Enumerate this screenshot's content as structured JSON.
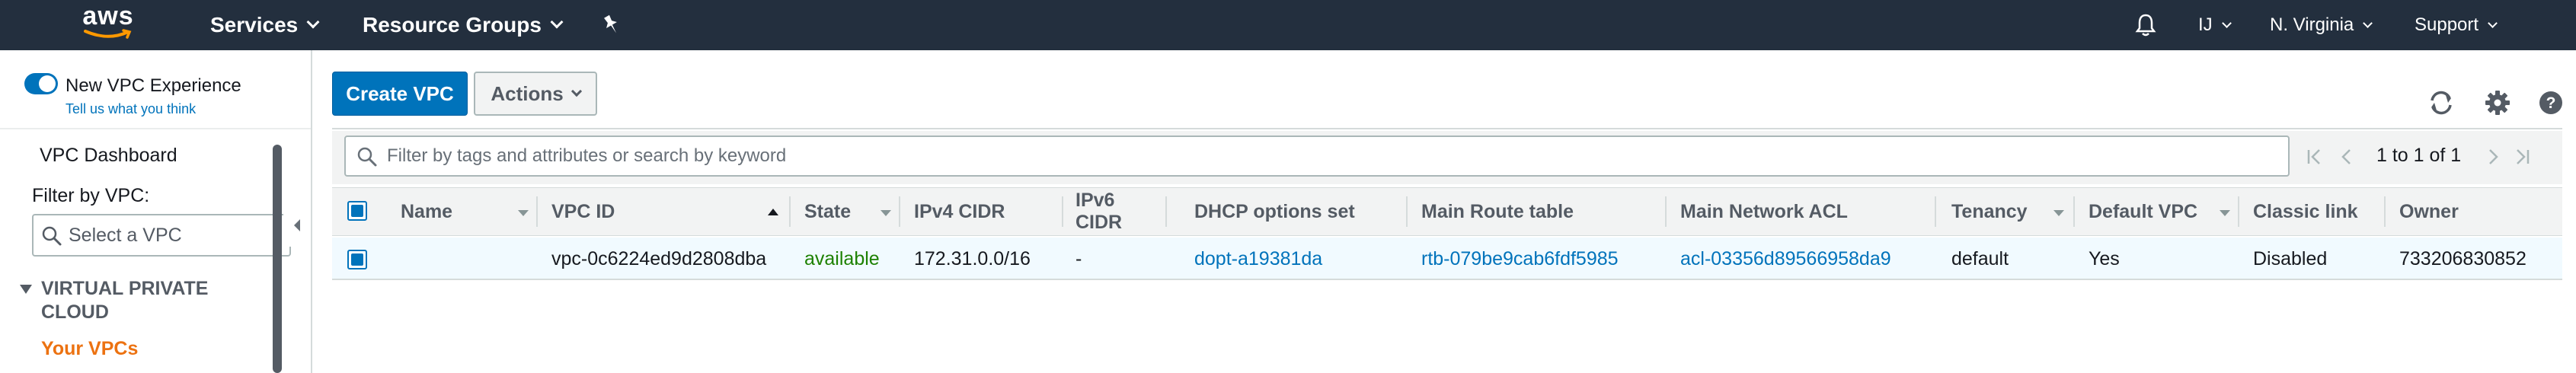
{
  "nav": {
    "logo": "aws",
    "services": "Services",
    "resource_groups": "Resource Groups",
    "pin_icon": "pin-icon",
    "bell_icon": "bell-icon",
    "user": "IJ",
    "region": "N. Virginia",
    "support": "Support"
  },
  "sidebar": {
    "toggle_label": "New VPC Experience",
    "tell_us": "Tell us what you think",
    "vpc_dashboard": "VPC Dashboard",
    "filter_label": "Filter by VPC:",
    "select_placeholder": "Select a VPC",
    "section_title_line1": "VIRTUAL PRIVATE",
    "section_title_line2": "CLOUD",
    "your_vpcs": "Your VPCs"
  },
  "toolbar": {
    "create_vpc": "Create VPC",
    "actions": "Actions",
    "icons": [
      "refresh-icon",
      "gear-icon",
      "help-icon"
    ]
  },
  "filter": {
    "placeholder": "Filter by tags and attributes or search by keyword",
    "pagination": "1 to 1 of 1"
  },
  "table": {
    "columns": [
      "Name",
      "VPC ID",
      "State",
      "IPv4 CIDR",
      "IPv6 CIDR",
      "DHCP options set",
      "Main Route table",
      "Main Network ACL",
      "Tenancy",
      "Default VPC",
      "Classic link",
      "Owner"
    ],
    "rows": [
      {
        "name": "",
        "vpc_id": "vpc-0c6224ed9d2808dba",
        "state": "available",
        "ipv4": "172.31.0.0/16",
        "ipv6": "-",
        "dhcp": "dopt-a19381da",
        "route_table": "rtb-079be9cab6fdf5985",
        "acl": "acl-03356d89566958da9",
        "tenancy": "default",
        "default_vpc": "Yes",
        "classic_link": "Disabled",
        "owner": "733206830852"
      }
    ]
  },
  "colors": {
    "nav_bg": "#232f3e",
    "primary": "#0073bb",
    "accent_orange": "#ec7211",
    "state_green": "#1d8102"
  }
}
